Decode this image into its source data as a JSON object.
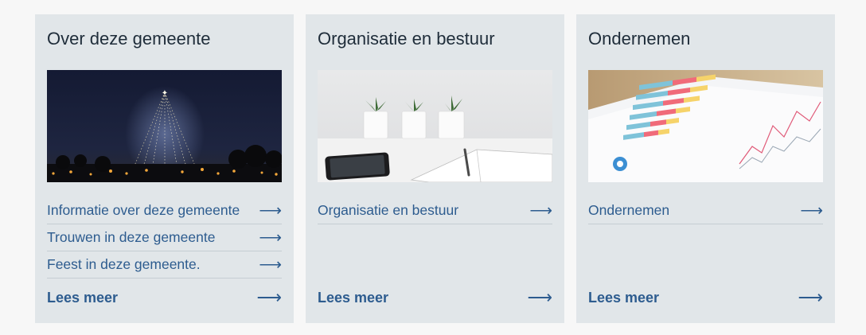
{
  "cards": [
    {
      "title": "Over deze gemeente",
      "image": "christmas-light-tree-at-night",
      "links": [
        {
          "label": "Informatie over deze gemeente",
          "arrow": "⟶"
        },
        {
          "label": "Trouwen in deze gemeente",
          "arrow": "⟶"
        },
        {
          "label": "Feest in deze gemeente.",
          "arrow": "⟶"
        }
      ],
      "more_label": "Lees meer",
      "more_arrow": "⟶"
    },
    {
      "title": "Organisatie en bestuur",
      "image": "desk-with-plants-phone-notebook",
      "links": [
        {
          "label": "Organisatie en bestuur",
          "arrow": "⟶"
        }
      ],
      "more_label": "Lees meer",
      "more_arrow": "⟶"
    },
    {
      "title": "Ondernemen",
      "image": "printed-bar-and-line-charts",
      "links": [
        {
          "label": "Ondernemen",
          "arrow": "⟶"
        }
      ],
      "more_label": "Lees meer",
      "more_arrow": "⟶"
    }
  ],
  "colors": {
    "card_bg": "#e1e6e9",
    "link": "#2d5c8f",
    "title": "#1f2d3a",
    "divider": "#c5cdd3"
  }
}
